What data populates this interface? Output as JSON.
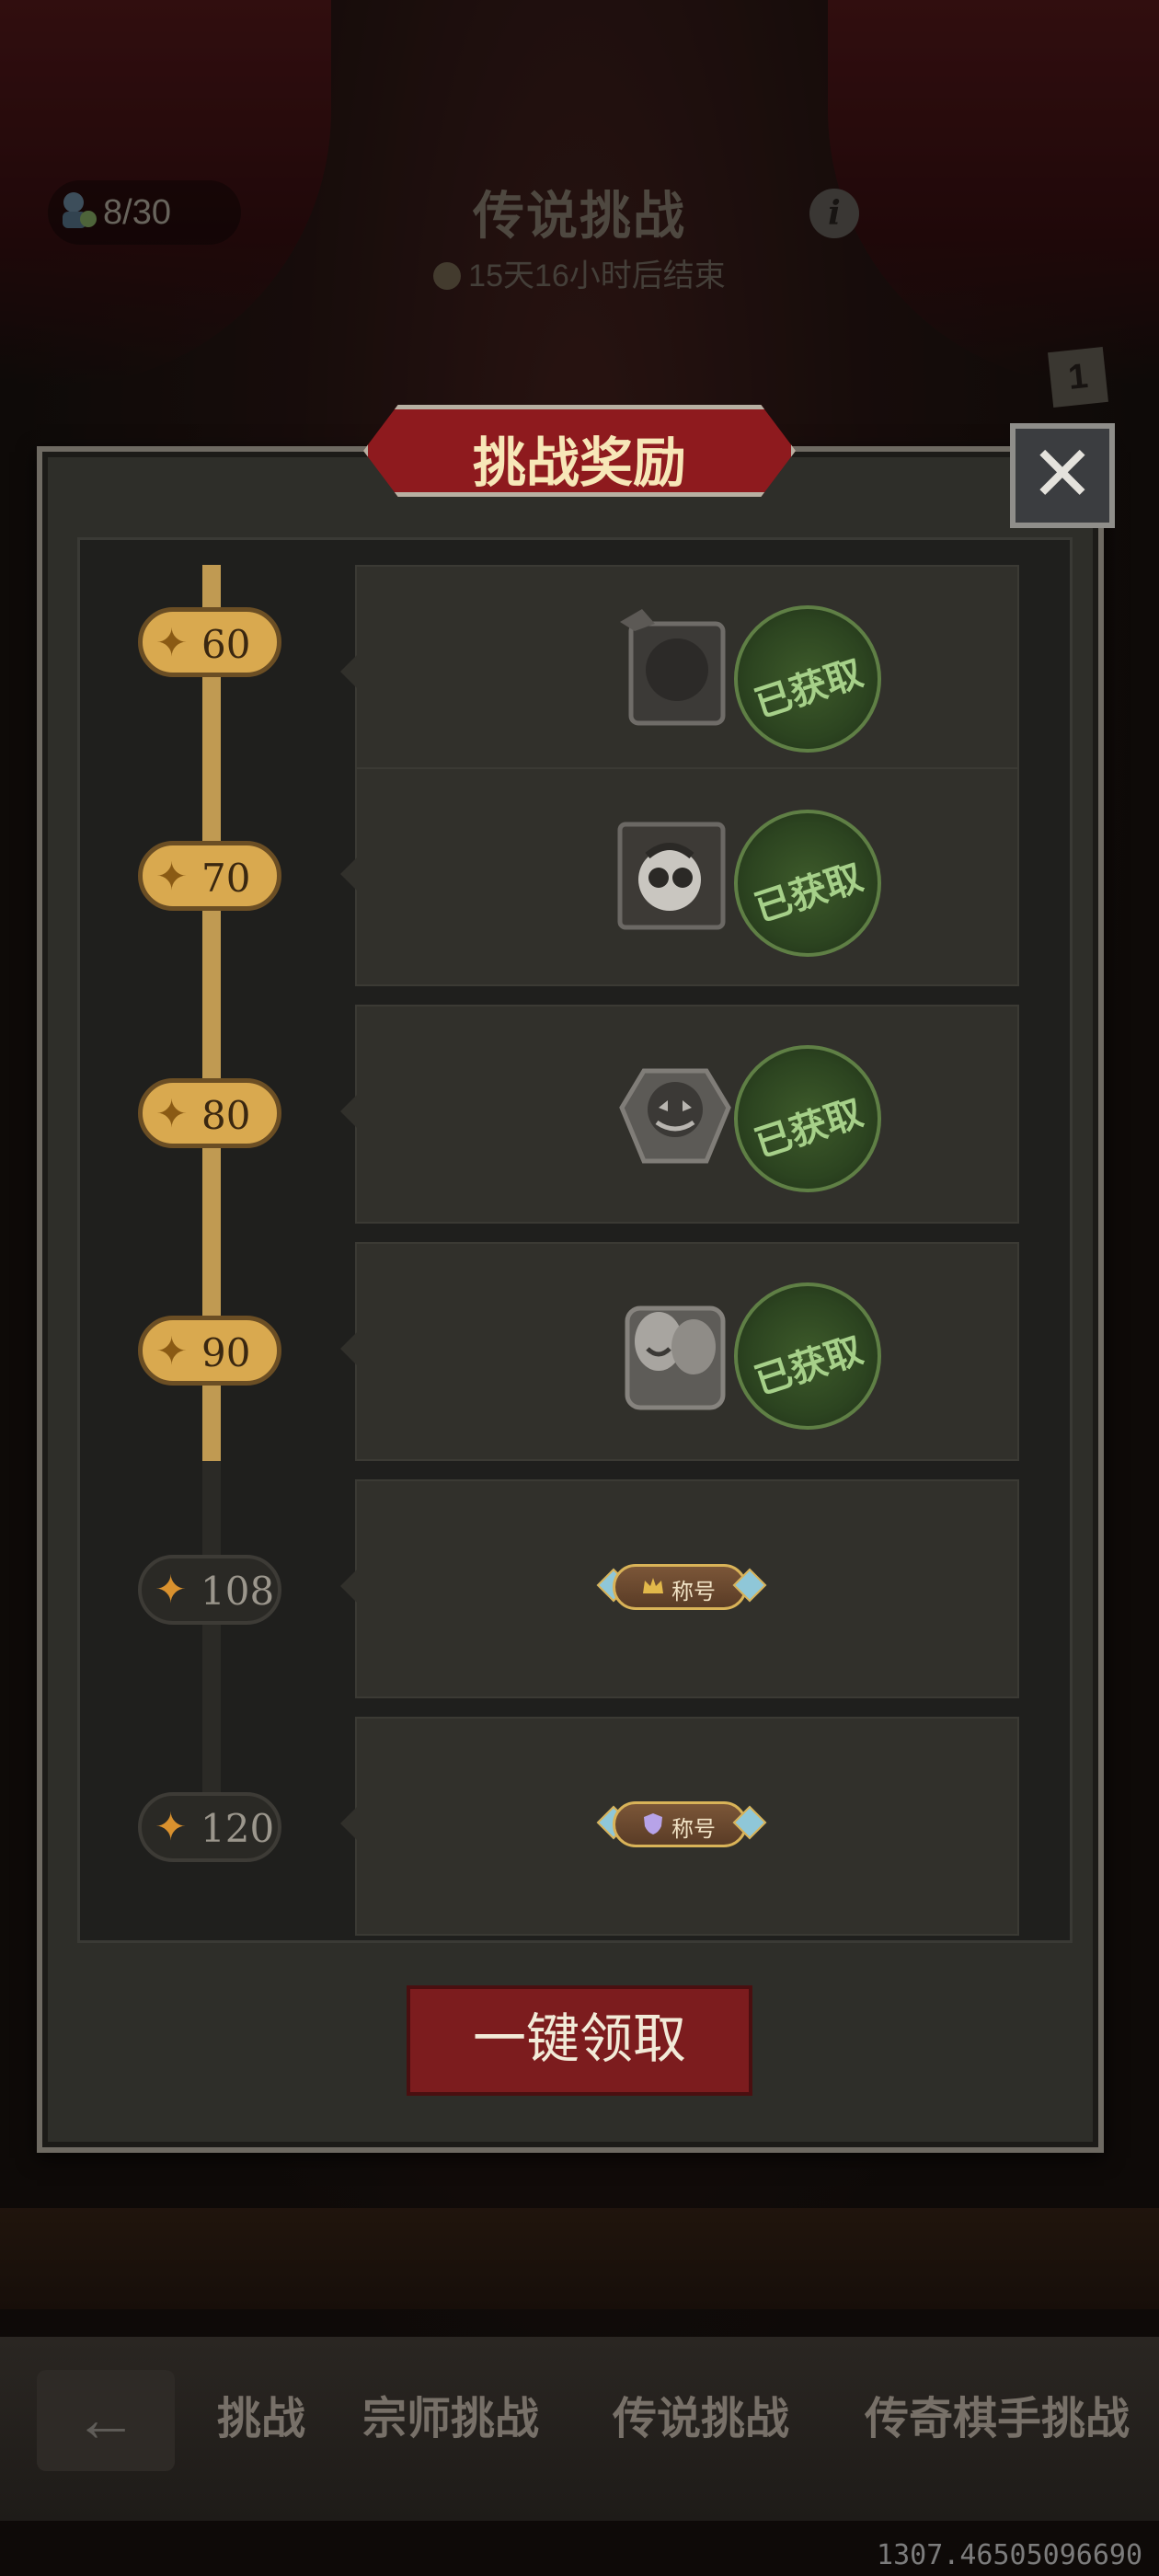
{
  "header": {
    "counter": "8/30",
    "title": "传说挑战",
    "subtitle": "15天16小时后结束",
    "info_icon": "i",
    "badge": "1"
  },
  "dialog": {
    "title": "挑战奖励",
    "close_icon": "✕",
    "milestones": [
      {
        "value": "60",
        "reached": true,
        "reward": "item",
        "claimed": true,
        "claimed_label": "已获取"
      },
      {
        "value": "70",
        "reached": true,
        "reward": "item",
        "claimed": true,
        "claimed_label": "已获取"
      },
      {
        "value": "80",
        "reached": true,
        "reward": "item",
        "claimed": true,
        "claimed_label": "已获取"
      },
      {
        "value": "90",
        "reached": true,
        "reward": "item",
        "claimed": true,
        "claimed_label": "已获取"
      },
      {
        "value": "108",
        "reached": false,
        "reward": "title",
        "title_label": "称号",
        "claimed": false
      },
      {
        "value": "120",
        "reached": false,
        "reward": "title",
        "title_label": "称号",
        "claimed": false
      }
    ],
    "claim_all_label": "一键领取"
  },
  "bottom_nav": {
    "back_icon": "←",
    "tabs": [
      "挑战",
      "宗师挑战",
      "传说挑战",
      "传奇棋手挑战"
    ]
  },
  "footer_readout": "1307.46505096690",
  "colors": {
    "accent_gold": "#d9a94f",
    "dialog_red": "#8e1a1e",
    "claimed_green": "#a6d089"
  }
}
